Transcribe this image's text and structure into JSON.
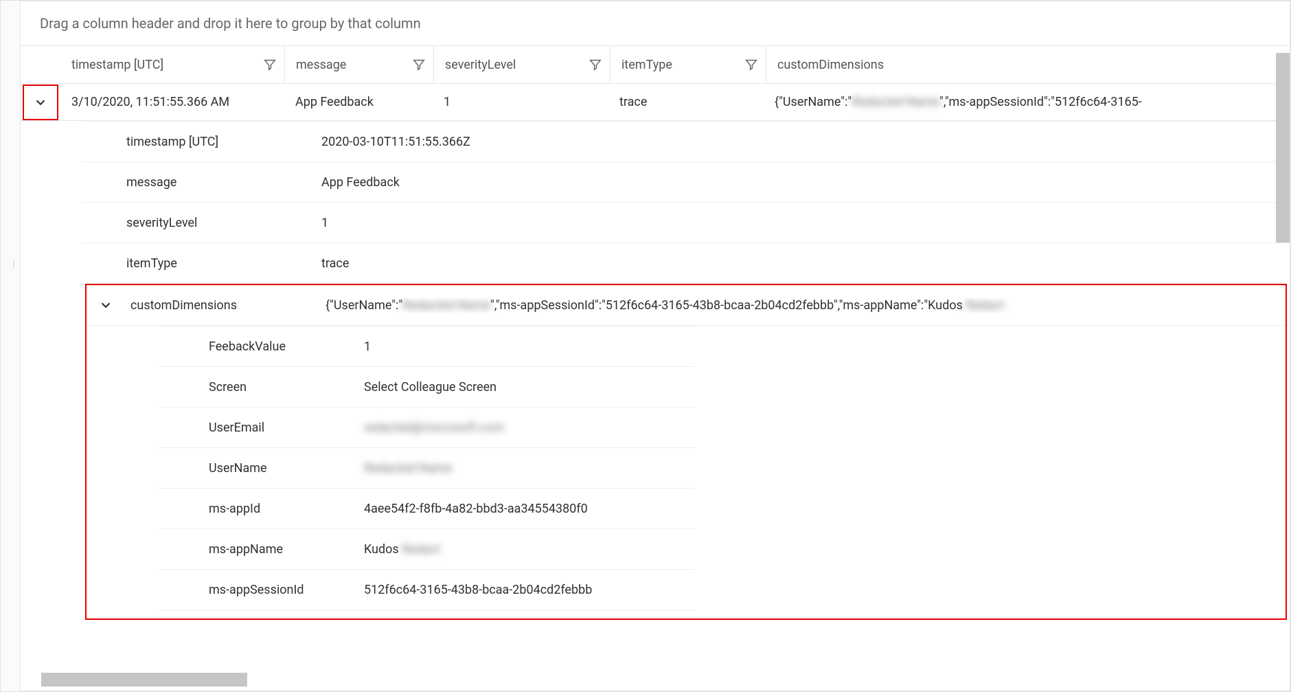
{
  "groupHint": "Drag a column header and drop it here to group by that column",
  "columns": {
    "timestamp": "timestamp [UTC]",
    "message": "message",
    "severityLevel": "severityLevel",
    "itemType": "itemType",
    "customDimensions": "customDimensions"
  },
  "row": {
    "timestamp": "3/10/2020, 11:51:55.366 AM",
    "message": "App Feedback",
    "severityLevel": "1",
    "itemType": "trace",
    "customDimensions_prefix": "{\"UserName\":\"",
    "customDimensions_blur1": "Redacted Name",
    "customDimensions_suffix": "\",\"ms-appSessionId\":\"512f6c64-3165-"
  },
  "details": {
    "timestamp_label": "timestamp [UTC]",
    "timestamp_value": "2020-03-10T11:51:55.366Z",
    "message_label": "message",
    "message_value": "App Feedback",
    "severity_label": "severityLevel",
    "severity_value": "1",
    "itemType_label": "itemType",
    "itemType_value": "trace",
    "custom_label": "customDimensions",
    "custom_prefix": "{\"UserName\":\"",
    "custom_blur1": "Redacted Name",
    "custom_mid": "\",\"ms-appSessionId\":\"512f6c64-3165-43b8-bcaa-2b04cd2febbb\",\"ms-appName\":\"Kudos ",
    "custom_blur2": "Redact"
  },
  "dim": {
    "feedback_label": "FeebackValue",
    "feedback_value": "1",
    "screen_label": "Screen",
    "screen_value": "Select Colleague Screen",
    "useremail_label": "UserEmail",
    "useremail_value": "redacted@microsoft.com",
    "username_label": "UserName",
    "username_value": "Redacted Name",
    "appid_label": "ms-appId",
    "appid_value": "4aee54f2-f8fb-4a82-bbd3-aa34554380f0",
    "appname_label": "ms-appName",
    "appname_value_prefix": "Kudos ",
    "appname_value_blur": "Redact",
    "session_label": "ms-appSessionId",
    "session_value": "512f6c64-3165-43b8-bcaa-2b04cd2febbb"
  }
}
